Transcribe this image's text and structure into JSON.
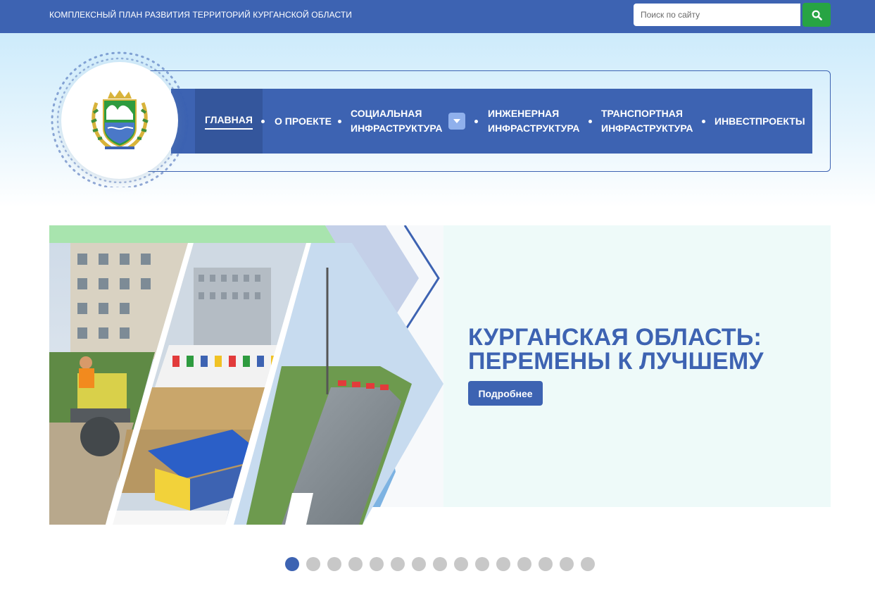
{
  "header": {
    "site_title": "КОМПЛЕКСНЫЙ ПЛАН РАЗВИТИЯ ТЕРРИТОРИЙ КУРГАНСКОЙ ОБЛАСТИ",
    "search": {
      "placeholder": "Поиск по сайту",
      "button_icon": "search-icon"
    }
  },
  "nav": {
    "items": [
      {
        "label": "ГЛАВНАЯ",
        "active": true
      },
      {
        "label": "О ПРОЕКТЕ"
      },
      {
        "label_line1": "СОЦИАЛЬНАЯ",
        "label_line2": "ИНФРАСТРУКТУРА",
        "has_dropdown": true
      },
      {
        "label_line1": "ИНЖЕНЕРНАЯ",
        "label_line2": "ИНФРАСТРУКТУРА"
      },
      {
        "label_line1": "ТРАНСПОРТНАЯ",
        "label_line2": "ИНФРАСТРУКТУРА"
      },
      {
        "label": "ИНВЕСТПРОЕКТЫ"
      }
    ],
    "dropdown_icon": "caret-down-icon"
  },
  "slider": {
    "heading_line1": "КУРГАНСКАЯ ОБЛАСТЬ:",
    "heading_line2": "ПЕРЕМЕНЫ К ЛУЧШЕМУ",
    "button_label": "Подробнее",
    "slide_count": 15,
    "current_slide": 1
  },
  "colors": {
    "primary": "#3d63b2",
    "search_button": "#27a443",
    "slide_bg": "#eefaf9",
    "dot_inactive": "#c8c8c8"
  }
}
